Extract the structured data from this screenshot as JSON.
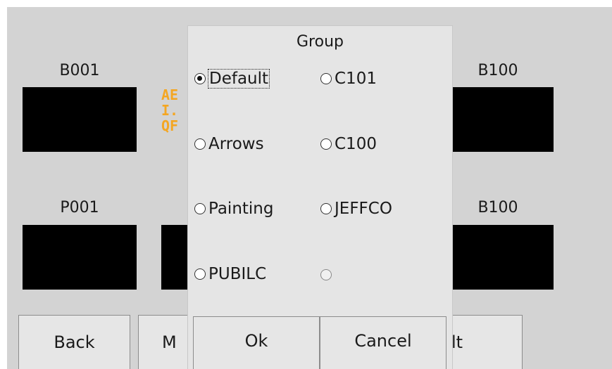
{
  "tiles": {
    "top_left_label": "B001",
    "top_right_label": "B100",
    "bottom_left_label": "P001",
    "bottom_right_label": "B100",
    "led_lines": "AE\nI.\nQF",
    "led_color": "#f4a622"
  },
  "bottom_bar": {
    "back_label": "Back",
    "middle_label_partial": "M",
    "right_label_partial": "lt"
  },
  "dialog": {
    "title": "Group",
    "options": [
      {
        "label": "Default",
        "checked": true
      },
      {
        "label": "C101",
        "checked": false
      },
      {
        "label": "Arrows",
        "checked": false
      },
      {
        "label": "C100",
        "checked": false
      },
      {
        "label": "Painting",
        "checked": false
      },
      {
        "label": "JEFFCO",
        "checked": false
      },
      {
        "label": "PUBILC",
        "checked": false
      },
      {
        "label": "",
        "checked": false
      }
    ],
    "ok_label": "Ok",
    "cancel_label": "Cancel"
  }
}
